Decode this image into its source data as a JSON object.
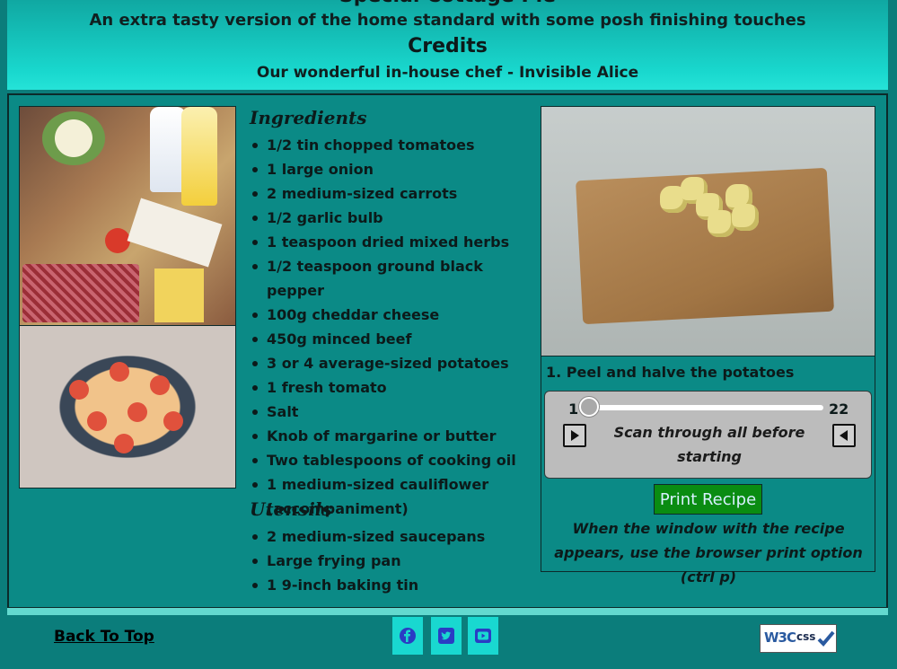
{
  "header": {
    "title": "Special Cottage Pie",
    "subtitle": "An extra tasty version of the home standard with some posh finishing touches",
    "credits_title": "Credits",
    "credits_text": "Our wonderful in-house chef - Invisible Alice"
  },
  "ingredients": {
    "heading": "Ingredients",
    "items": [
      "1/2 tin chopped tomatoes",
      "1 large onion",
      "2 medium-sized carrots",
      "1/2 garlic bulb",
      "1 teaspoon dried mixed herbs",
      "1/2 teaspoon ground black pepper",
      "100g cheddar cheese",
      "450g minced beef",
      "3 or 4 average-sized potatoes",
      "1 fresh tomato",
      "Salt",
      "Knob of margarine or butter",
      "Two tablespoons of cooking oil",
      "1 medium-sized cauliflower (accompaniment)"
    ]
  },
  "utensils": {
    "heading": "Utensils",
    "items": [
      "2 medium-sized saucepans",
      "Large frying pan",
      "1 9-inch baking tin"
    ]
  },
  "steps": {
    "current_text": "1. Peel and halve the potatoes",
    "slider_min": "1",
    "slider_max": "22",
    "slider_value": 1,
    "scan_text": "Scan through all before starting"
  },
  "print": {
    "button_label": "Print Recipe",
    "note": "When the window with the recipe appears, use the browser print option (ctrl p)"
  },
  "footer": {
    "back_to_top": "Back To Top",
    "social_icons": [
      "facebook-icon",
      "twitter-icon",
      "youtube-icon"
    ],
    "badge_w3": "W3C",
    "badge_css": "css"
  },
  "colors": {
    "page_bg": "#0b7d7b",
    "header_gradient_top": "#10a8a2",
    "header_gradient_bottom": "#25e3d8",
    "print_button": "#0a8c12",
    "social_bg": "#19d8d0",
    "social_icon": "#2a3cc4"
  }
}
